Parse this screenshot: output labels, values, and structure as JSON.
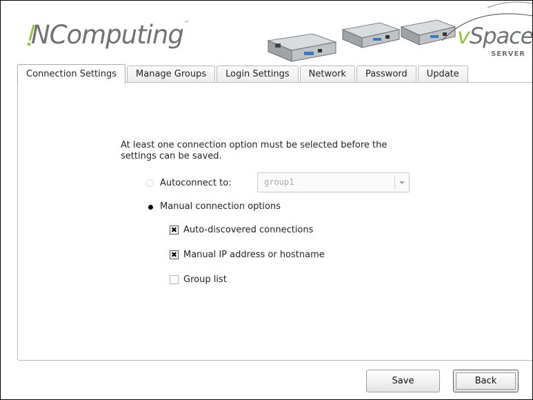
{
  "brand": {
    "name": "NComputing",
    "product": "vSpace",
    "product_sub": "SERVER",
    "tm": "™"
  },
  "tabs": [
    {
      "label": "Connection Settings",
      "active": true
    },
    {
      "label": "Manage Groups",
      "active": false
    },
    {
      "label": "Login Settings",
      "active": false
    },
    {
      "label": "Network",
      "active": false
    },
    {
      "label": "Password",
      "active": false
    },
    {
      "label": "Update",
      "active": false
    }
  ],
  "connection": {
    "notice": "At least one connection option must be selected before the settings can be saved.",
    "autoconnect_label": "Autoconnect to:",
    "autoconnect_selected": false,
    "autoconnect_enabled": false,
    "group_value": "group1",
    "manual_label": "Manual connection options",
    "manual_selected": true,
    "options": [
      {
        "label": "Auto-discovered connections",
        "checked": true
      },
      {
        "label": "Manual IP address or hostname",
        "checked": true
      },
      {
        "label": "Group list",
        "checked": false
      }
    ]
  },
  "buttons": {
    "save": "Save",
    "back": "Back"
  },
  "colors": {
    "accent_green": "#8dc63f",
    "logo_gray": "#6f7274"
  }
}
